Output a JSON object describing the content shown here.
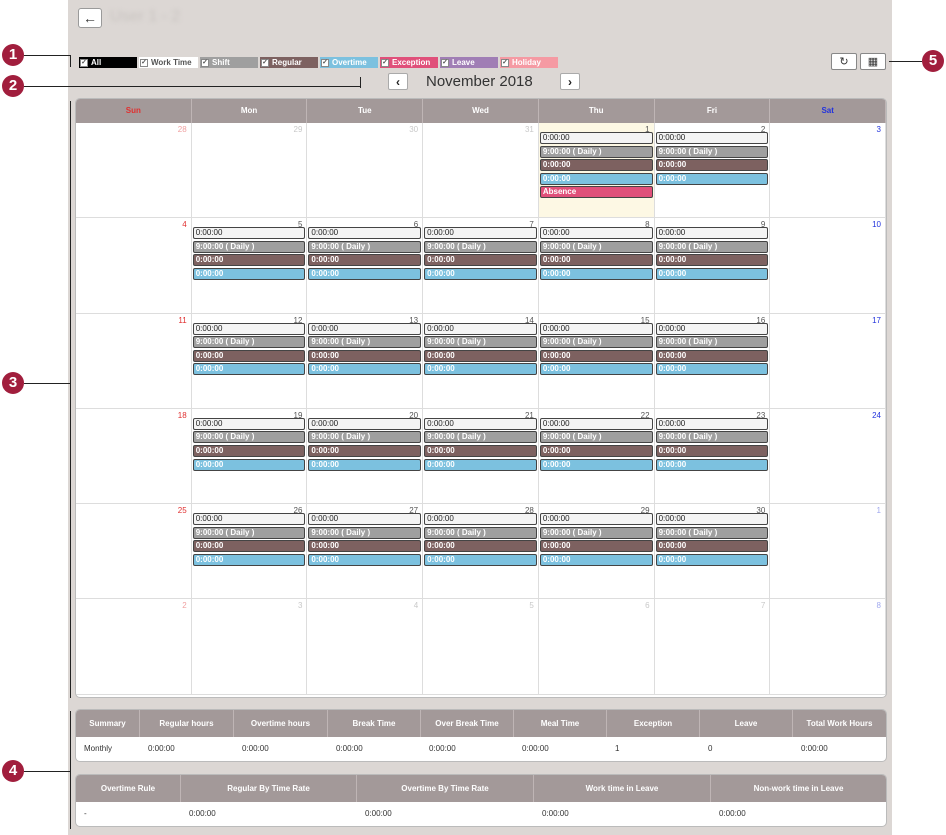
{
  "header": {
    "user_title": "User 1 - 2"
  },
  "filters": [
    {
      "label": "All",
      "bg": "#000000"
    },
    {
      "label": "Work Time",
      "bg": "#ffffff",
      "fg": "#555555"
    },
    {
      "label": "Shift",
      "bg": "#9f9f9f"
    },
    {
      "label": "Regular",
      "bg": "#7d6160"
    },
    {
      "label": "Overtime",
      "bg": "#7cc1df"
    },
    {
      "label": "Exception",
      "bg": "#e0507a"
    },
    {
      "label": "Leave",
      "bg": "#a07eb5"
    },
    {
      "label": "Holiday",
      "bg": "#f59aa3"
    }
  ],
  "calendar": {
    "month": "November 2018",
    "weekdays": [
      "Sun",
      "Mon",
      "Tue",
      "Wed",
      "Thu",
      "Fri",
      "Sat"
    ],
    "weeks": [
      [
        {
          "day": "28",
          "faded": true,
          "events": []
        },
        {
          "day": "29",
          "faded": true,
          "events": []
        },
        {
          "day": "30",
          "faded": true,
          "events": []
        },
        {
          "day": "31",
          "faded": true,
          "events": []
        },
        {
          "day": "1",
          "today": true,
          "events": [
            {
              "type": "wt",
              "text": "0:00:00"
            },
            {
              "type": "sh",
              "text": "9:00:00 ( Daily )"
            },
            {
              "type": "rg",
              "text": "0:00:00"
            },
            {
              "type": "ot",
              "text": "0:00:00"
            },
            {
              "type": "ab",
              "text": "Absence"
            }
          ]
        },
        {
          "day": "2",
          "events": [
            {
              "type": "wt",
              "text": "0:00:00"
            },
            {
              "type": "sh",
              "text": "9:00:00 ( Daily )"
            },
            {
              "type": "rg",
              "text": "0:00:00"
            },
            {
              "type": "ot",
              "text": "0:00:00"
            }
          ]
        },
        {
          "day": "3",
          "events": []
        }
      ],
      [
        {
          "day": "4",
          "events": []
        },
        {
          "day": "5",
          "events": [
            {
              "type": "wt",
              "text": "0:00:00"
            },
            {
              "type": "sh",
              "text": "9:00:00 ( Daily )"
            },
            {
              "type": "rg",
              "text": "0:00:00"
            },
            {
              "type": "ot",
              "text": "0:00:00"
            }
          ]
        },
        {
          "day": "6",
          "events": [
            {
              "type": "wt",
              "text": "0:00:00"
            },
            {
              "type": "sh",
              "text": "9:00:00 ( Daily )"
            },
            {
              "type": "rg",
              "text": "0:00:00"
            },
            {
              "type": "ot",
              "text": "0:00:00"
            }
          ]
        },
        {
          "day": "7",
          "events": [
            {
              "type": "wt",
              "text": "0:00:00"
            },
            {
              "type": "sh",
              "text": "9:00:00 ( Daily )"
            },
            {
              "type": "rg",
              "text": "0:00:00"
            },
            {
              "type": "ot",
              "text": "0:00:00"
            }
          ]
        },
        {
          "day": "8",
          "events": [
            {
              "type": "wt",
              "text": "0:00:00"
            },
            {
              "type": "sh",
              "text": "9:00:00 ( Daily )"
            },
            {
              "type": "rg",
              "text": "0:00:00"
            },
            {
              "type": "ot",
              "text": "0:00:00"
            }
          ]
        },
        {
          "day": "9",
          "events": [
            {
              "type": "wt",
              "text": "0:00:00"
            },
            {
              "type": "sh",
              "text": "9:00:00 ( Daily )"
            },
            {
              "type": "rg",
              "text": "0:00:00"
            },
            {
              "type": "ot",
              "text": "0:00:00"
            }
          ]
        },
        {
          "day": "10",
          "events": []
        }
      ],
      [
        {
          "day": "11",
          "events": []
        },
        {
          "day": "12",
          "events": [
            {
              "type": "wt",
              "text": "0:00:00"
            },
            {
              "type": "sh",
              "text": "9:00:00 ( Daily )"
            },
            {
              "type": "rg",
              "text": "0:00:00"
            },
            {
              "type": "ot",
              "text": "0:00:00"
            }
          ]
        },
        {
          "day": "13",
          "events": [
            {
              "type": "wt",
              "text": "0:00:00"
            },
            {
              "type": "sh",
              "text": "9:00:00 ( Daily )"
            },
            {
              "type": "rg",
              "text": "0:00:00"
            },
            {
              "type": "ot",
              "text": "0:00:00"
            }
          ]
        },
        {
          "day": "14",
          "events": [
            {
              "type": "wt",
              "text": "0:00:00"
            },
            {
              "type": "sh",
              "text": "9:00:00 ( Daily )"
            },
            {
              "type": "rg",
              "text": "0:00:00"
            },
            {
              "type": "ot",
              "text": "0:00:00"
            }
          ]
        },
        {
          "day": "15",
          "events": [
            {
              "type": "wt",
              "text": "0:00:00"
            },
            {
              "type": "sh",
              "text": "9:00:00 ( Daily )"
            },
            {
              "type": "rg",
              "text": "0:00:00"
            },
            {
              "type": "ot",
              "text": "0:00:00"
            }
          ]
        },
        {
          "day": "16",
          "events": [
            {
              "type": "wt",
              "text": "0:00:00"
            },
            {
              "type": "sh",
              "text": "9:00:00 ( Daily )"
            },
            {
              "type": "rg",
              "text": "0:00:00"
            },
            {
              "type": "ot",
              "text": "0:00:00"
            }
          ]
        },
        {
          "day": "17",
          "events": []
        }
      ],
      [
        {
          "day": "18",
          "events": []
        },
        {
          "day": "19",
          "events": [
            {
              "type": "wt",
              "text": "0:00:00"
            },
            {
              "type": "sh",
              "text": "9:00:00 ( Daily )"
            },
            {
              "type": "rg",
              "text": "0:00:00"
            },
            {
              "type": "ot",
              "text": "0:00:00"
            }
          ]
        },
        {
          "day": "20",
          "events": [
            {
              "type": "wt",
              "text": "0:00:00"
            },
            {
              "type": "sh",
              "text": "9:00:00 ( Daily )"
            },
            {
              "type": "rg",
              "text": "0:00:00"
            },
            {
              "type": "ot",
              "text": "0:00:00"
            }
          ]
        },
        {
          "day": "21",
          "events": [
            {
              "type": "wt",
              "text": "0:00:00"
            },
            {
              "type": "sh",
              "text": "9:00:00 ( Daily )"
            },
            {
              "type": "rg",
              "text": "0:00:00"
            },
            {
              "type": "ot",
              "text": "0:00:00"
            }
          ]
        },
        {
          "day": "22",
          "events": [
            {
              "type": "wt",
              "text": "0:00:00"
            },
            {
              "type": "sh",
              "text": "9:00:00 ( Daily )"
            },
            {
              "type": "rg",
              "text": "0:00:00"
            },
            {
              "type": "ot",
              "text": "0:00:00"
            }
          ]
        },
        {
          "day": "23",
          "events": [
            {
              "type": "wt",
              "text": "0:00:00"
            },
            {
              "type": "sh",
              "text": "9:00:00 ( Daily )"
            },
            {
              "type": "rg",
              "text": "0:00:00"
            },
            {
              "type": "ot",
              "text": "0:00:00"
            }
          ]
        },
        {
          "day": "24",
          "events": []
        }
      ],
      [
        {
          "day": "25",
          "events": []
        },
        {
          "day": "26",
          "events": [
            {
              "type": "wt",
              "text": "0:00:00"
            },
            {
              "type": "sh",
              "text": "9:00:00 ( Daily )"
            },
            {
              "type": "rg",
              "text": "0:00:00"
            },
            {
              "type": "ot",
              "text": "0:00:00"
            }
          ]
        },
        {
          "day": "27",
          "events": [
            {
              "type": "wt",
              "text": "0:00:00"
            },
            {
              "type": "sh",
              "text": "9:00:00 ( Daily )"
            },
            {
              "type": "rg",
              "text": "0:00:00"
            },
            {
              "type": "ot",
              "text": "0:00:00"
            }
          ]
        },
        {
          "day": "28",
          "events": [
            {
              "type": "wt",
              "text": "0:00:00"
            },
            {
              "type": "sh",
              "text": "9:00:00 ( Daily )"
            },
            {
              "type": "rg",
              "text": "0:00:00"
            },
            {
              "type": "ot",
              "text": "0:00:00"
            }
          ]
        },
        {
          "day": "29",
          "events": [
            {
              "type": "wt",
              "text": "0:00:00"
            },
            {
              "type": "sh",
              "text": "9:00:00 ( Daily )"
            },
            {
              "type": "rg",
              "text": "0:00:00"
            },
            {
              "type": "ot",
              "text": "0:00:00"
            }
          ]
        },
        {
          "day": "30",
          "events": [
            {
              "type": "wt",
              "text": "0:00:00"
            },
            {
              "type": "sh",
              "text": "9:00:00 ( Daily )"
            },
            {
              "type": "rg",
              "text": "0:00:00"
            },
            {
              "type": "ot",
              "text": "0:00:00"
            }
          ]
        },
        {
          "day": "1",
          "faded": true,
          "events": []
        }
      ],
      [
        {
          "day": "2",
          "faded": true,
          "events": []
        },
        {
          "day": "3",
          "faded": true,
          "events": []
        },
        {
          "day": "4",
          "faded": true,
          "events": []
        },
        {
          "day": "5",
          "faded": true,
          "events": []
        },
        {
          "day": "6",
          "faded": true,
          "events": []
        },
        {
          "day": "7",
          "faded": true,
          "events": []
        },
        {
          "day": "8",
          "faded": true,
          "events": []
        }
      ]
    ]
  },
  "summary1": {
    "headers": [
      "Summary",
      "Regular hours",
      "Overtime hours",
      "Break Time",
      "Over Break Time",
      "Meal Time",
      "Exception",
      "Leave",
      "Total Work Hours"
    ],
    "row": [
      "Monthly",
      "0:00:00",
      "0:00:00",
      "0:00:00",
      "0:00:00",
      "0:00:00",
      "1",
      "0",
      "0:00:00"
    ]
  },
  "summary2": {
    "headers": [
      "Overtime Rule",
      "Regular By Time Rate",
      "Overtime By Time Rate",
      "Work time in Leave",
      "Non-work time in Leave"
    ],
    "row": [
      "-",
      "0:00:00",
      "0:00:00",
      "0:00:00",
      "0:00:00"
    ]
  },
  "callouts": [
    "1",
    "2",
    "3",
    "4",
    "5"
  ]
}
